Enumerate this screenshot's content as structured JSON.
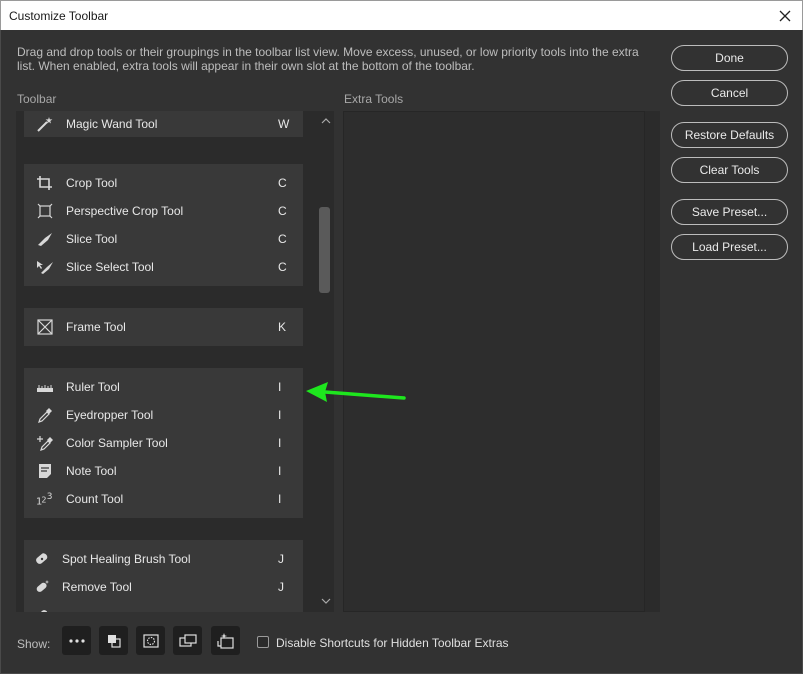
{
  "window": {
    "title": "Customize Toolbar"
  },
  "description": "Drag and drop tools or their groupings in the toolbar list view. Move excess, unused, or low priority tools into the extra list. When enabled, extra tools will appear in their own slot at the bottom of the toolbar.",
  "toolbar_label": "Toolbar",
  "extra_label": "Extra Tools",
  "groups": [
    {
      "tools": [
        {
          "name": "Magic Wand Tool",
          "key": "W",
          "icon": "magic-wand-icon"
        }
      ]
    },
    {
      "tools": [
        {
          "name": "Crop Tool",
          "key": "C",
          "icon": "crop-icon"
        },
        {
          "name": "Perspective Crop Tool",
          "key": "C",
          "icon": "perspective-crop-icon"
        },
        {
          "name": "Slice Tool",
          "key": "C",
          "icon": "slice-icon"
        },
        {
          "name": "Slice Select Tool",
          "key": "C",
          "icon": "slice-select-icon"
        }
      ]
    },
    {
      "tools": [
        {
          "name": "Frame Tool",
          "key": "K",
          "icon": "frame-icon"
        }
      ]
    },
    {
      "tools": [
        {
          "name": "Ruler Tool",
          "key": "I",
          "icon": "ruler-icon"
        },
        {
          "name": "Eyedropper Tool",
          "key": "I",
          "icon": "eyedropper-icon"
        },
        {
          "name": "Color Sampler Tool",
          "key": "I",
          "icon": "color-sampler-icon"
        },
        {
          "name": "Note Tool",
          "key": "I",
          "icon": "note-icon"
        },
        {
          "name": "Count Tool",
          "key": "I",
          "icon": "count-icon"
        }
      ]
    },
    {
      "tools": [
        {
          "name": "Spot Healing Brush Tool",
          "key": "J",
          "icon": "spot-healing-brush-icon"
        },
        {
          "name": "Remove Tool",
          "key": "J",
          "icon": "remove-tool-icon"
        }
      ]
    }
  ],
  "buttons": {
    "done": "Done",
    "cancel": "Cancel",
    "restore_defaults": "Restore Defaults",
    "clear_tools": "Clear Tools",
    "save_preset": "Save Preset...",
    "load_preset": "Load Preset..."
  },
  "footer": {
    "show_label": "Show:",
    "show_icons": [
      "more-icon",
      "foreground-background-icon",
      "quick-mask-icon",
      "screen-mode-icon",
      "edit-toolbar-icon"
    ],
    "checkbox_label": "Disable Shortcuts for Hidden Toolbar Extras",
    "checkbox_checked": false
  },
  "annotation": {
    "icon": "green-arrow-icon",
    "color": "#1ee61e"
  },
  "colors": {
    "dialog_bg": "#323232",
    "list_bg": "#2b2b2b",
    "group_bg": "#393939",
    "text": "#e8e8e8"
  }
}
